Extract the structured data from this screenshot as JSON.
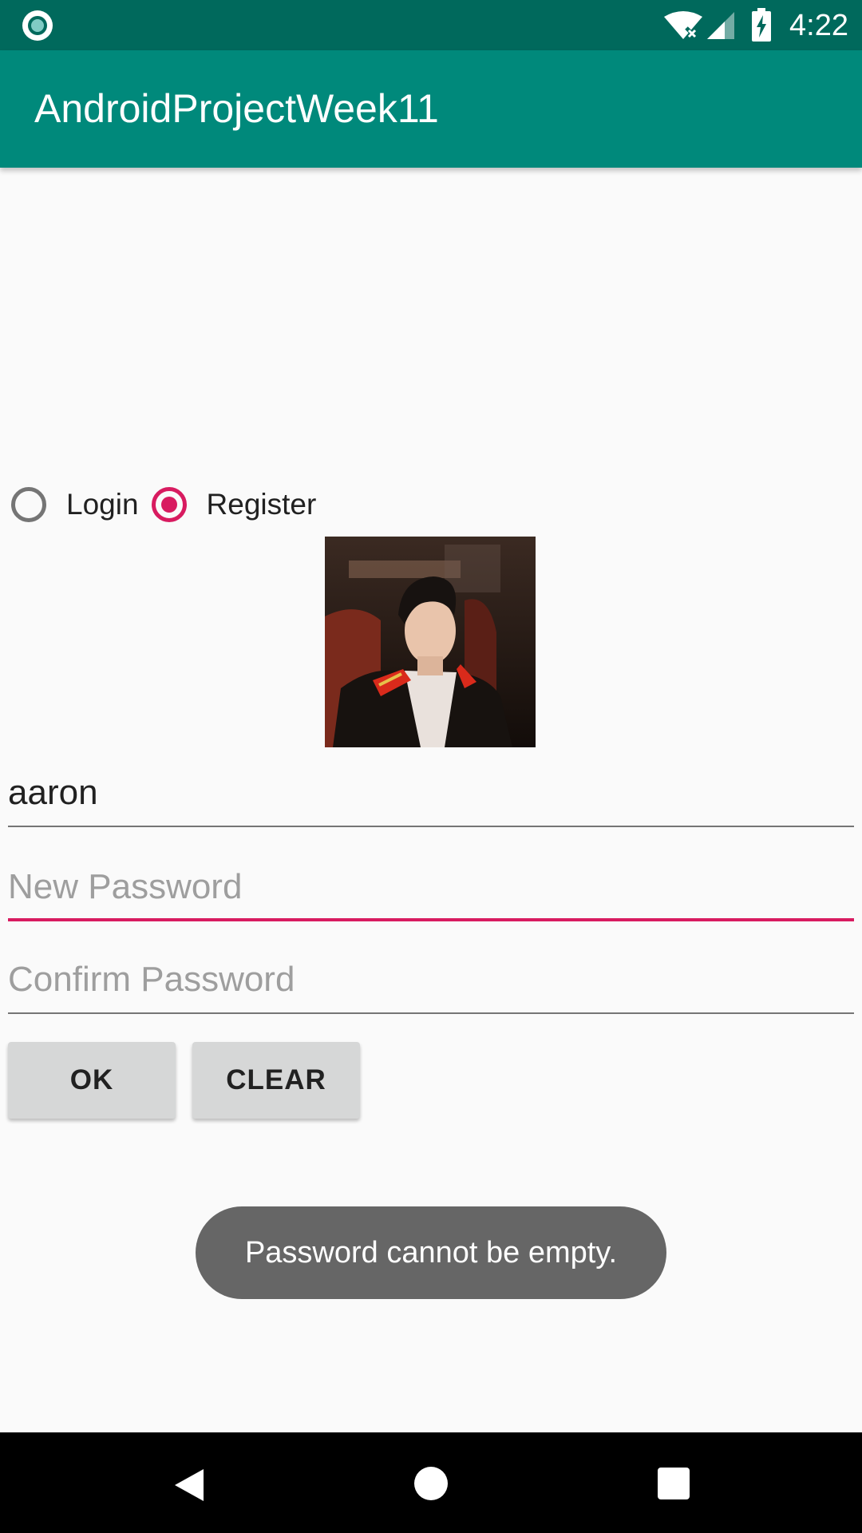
{
  "status_bar": {
    "time": "4:22",
    "icons": [
      "app-notification-icon",
      "wifi-icon",
      "signal-icon",
      "battery-charging-icon"
    ]
  },
  "app_bar": {
    "title": "AndroidProjectWeek11"
  },
  "mode_radio": {
    "options": [
      {
        "label": "Login",
        "checked": false
      },
      {
        "label": "Register",
        "checked": true
      }
    ]
  },
  "form": {
    "username": {
      "value": "aaron",
      "placeholder": ""
    },
    "new_password": {
      "value": "",
      "placeholder": "New Password",
      "focused": true
    },
    "confirm_password": {
      "value": "",
      "placeholder": "Confirm Password"
    }
  },
  "buttons": {
    "ok_label": "OK",
    "clear_label": "CLEAR"
  },
  "toast": {
    "message": "Password cannot be empty."
  },
  "nav_bar": {
    "icons": [
      "back-icon",
      "home-icon",
      "recent-apps-icon"
    ]
  },
  "colors": {
    "status_bar": "#00695c",
    "app_bar": "#00897b",
    "accent": "#d81b60",
    "background": "#fafafa",
    "toast": "#666666"
  }
}
